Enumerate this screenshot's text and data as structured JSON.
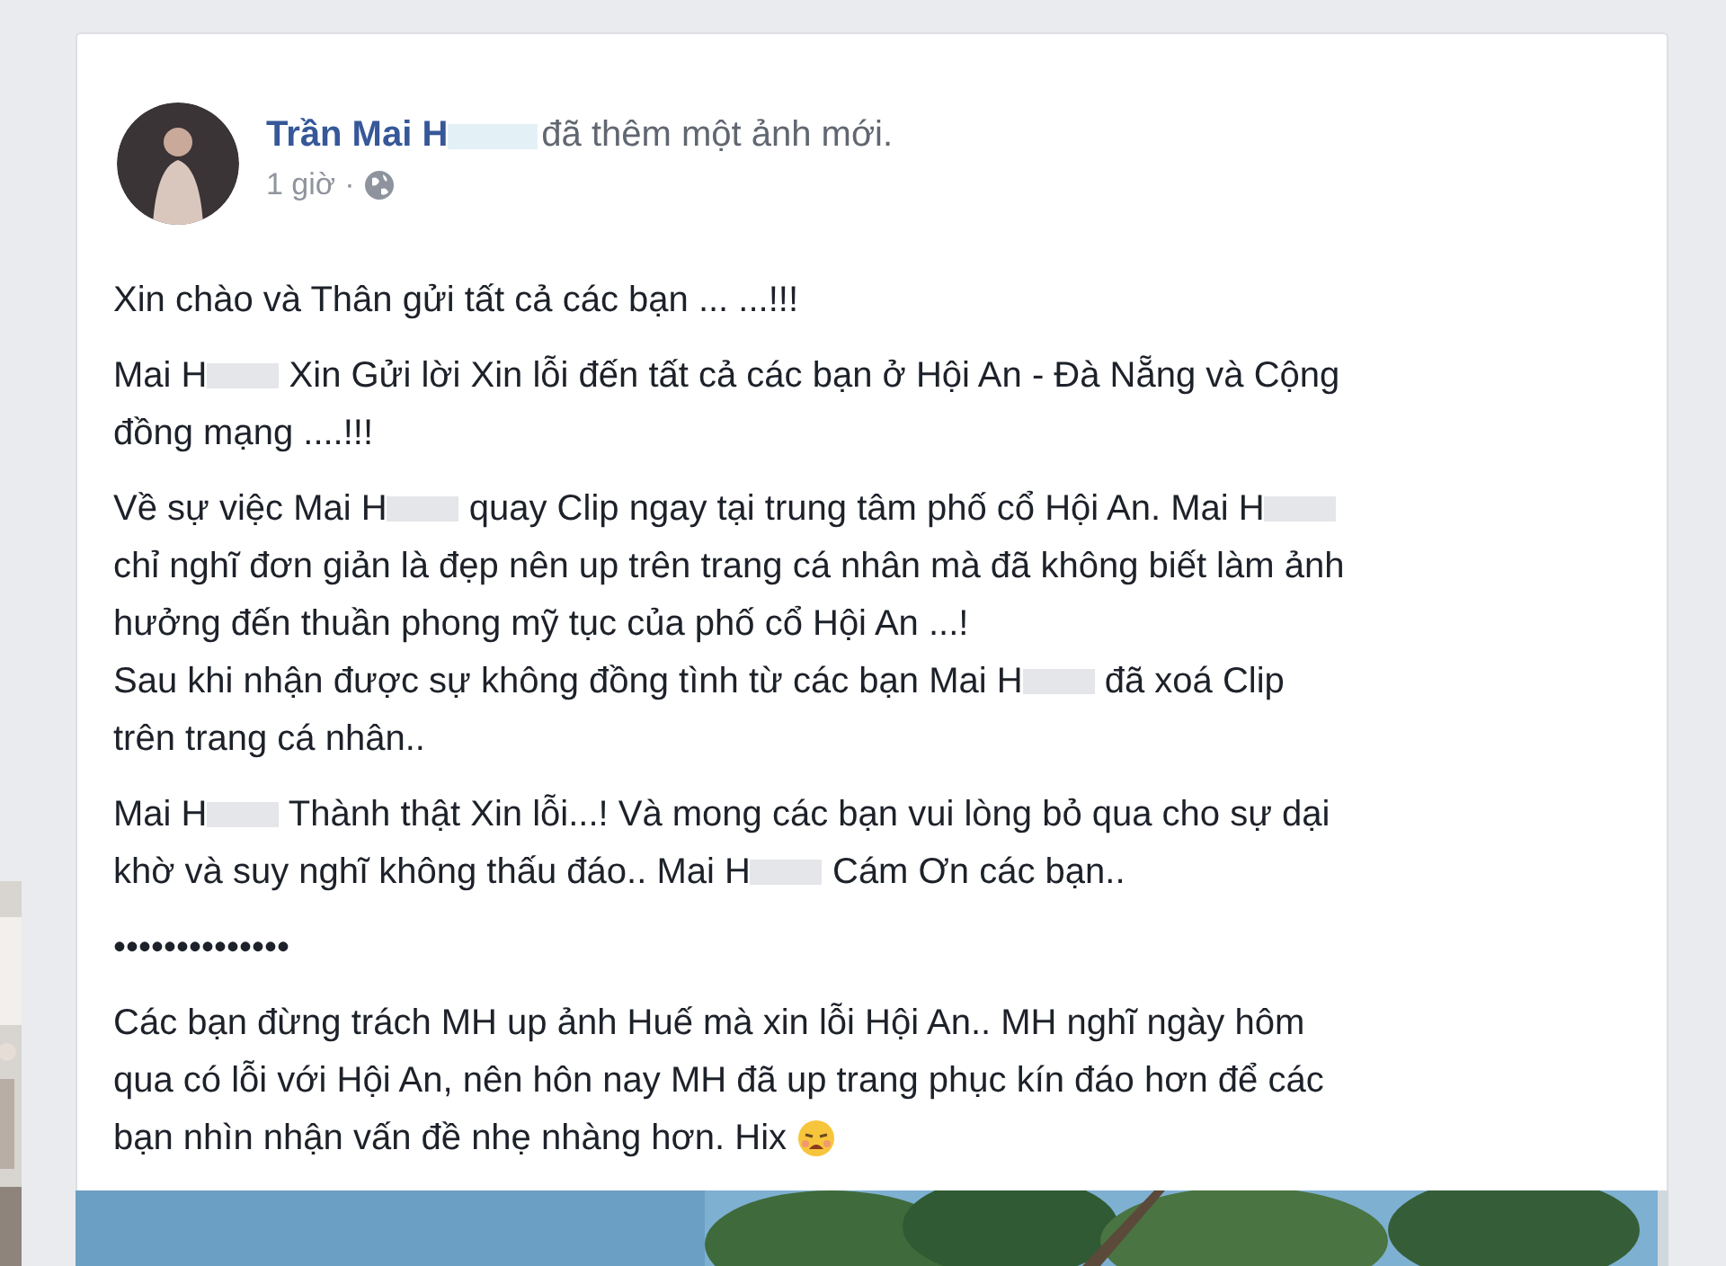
{
  "post": {
    "author": [
      {
        "kind": "text",
        "text": "Trần Mai H"
      },
      {
        "kind": "redaction"
      }
    ],
    "action": "đã thêm một ảnh mới.",
    "time": "1 giờ",
    "separator": "·",
    "paragraphs": [
      {
        "lines": [
          [
            {
              "kind": "text",
              "text": "Xin chào và Thân gửi tất cả các bạn ... ...!!!"
            }
          ]
        ]
      },
      {
        "lines": [
          [
            {
              "kind": "text",
              "text": "Mai H"
            },
            {
              "kind": "redaction"
            },
            {
              "kind": "text",
              "text": " Xin Gửi lời Xin lỗi đến tất cả các bạn ở Hội An - Đà Nẵng và Cộng"
            }
          ],
          [
            {
              "kind": "text",
              "text": "đồng mạng ....!!!"
            }
          ]
        ]
      },
      {
        "lines": [
          [
            {
              "kind": "text",
              "text": "Về sự việc Mai H"
            },
            {
              "kind": "redaction"
            },
            {
              "kind": "text",
              "text": " quay Clip ngay tại trung tâm phố cổ Hội An. Mai H"
            },
            {
              "kind": "redaction"
            }
          ],
          [
            {
              "kind": "text",
              "text": "chỉ nghĩ đơn giản là đẹp nên up trên trang cá nhân mà đã không biết làm ảnh"
            }
          ],
          [
            {
              "kind": "text",
              "text": "hưởng đến thuần phong mỹ tục của phố cổ Hội An ...!"
            }
          ],
          [
            {
              "kind": "text",
              "text": "Sau khi nhận được sự không đồng tình từ các bạn Mai H"
            },
            {
              "kind": "redaction"
            },
            {
              "kind": "text",
              "text": " đã xoá Clip"
            }
          ],
          [
            {
              "kind": "text",
              "text": "trên trang cá nhân.."
            }
          ]
        ]
      },
      {
        "lines": [
          [
            {
              "kind": "text",
              "text": "Mai H"
            },
            {
              "kind": "redaction"
            },
            {
              "kind": "text",
              "text": " Thành thật Xin lỗi...! Và mong các bạn vui lòng bỏ qua cho sự dại"
            }
          ],
          [
            {
              "kind": "text",
              "text": "khờ và suy nghĩ không thấu đáo.. Mai H"
            },
            {
              "kind": "redaction"
            },
            {
              "kind": "text",
              "text": " Cám Ơn các bạn.."
            }
          ]
        ]
      },
      {
        "lines": [
          [
            {
              "kind": "text",
              "text": "••••••••••••••"
            }
          ]
        ]
      },
      {
        "lines": [
          [
            {
              "kind": "text",
              "text": "Các bạn đừng trách MH up ảnh Huế mà xin lỗi Hội An.. MH nghĩ ngày hôm"
            }
          ],
          [
            {
              "kind": "text",
              "text": "qua có lỗi với Hội An, nên hôn nay MH đã up trang phục kín đáo hơn để các"
            }
          ],
          [
            {
              "kind": "text",
              "text": "bạn nhìn nhận vấn đề nhẹ nhàng hơn. Hix "
            },
            {
              "kind": "emoji"
            }
          ]
        ]
      }
    ]
  }
}
